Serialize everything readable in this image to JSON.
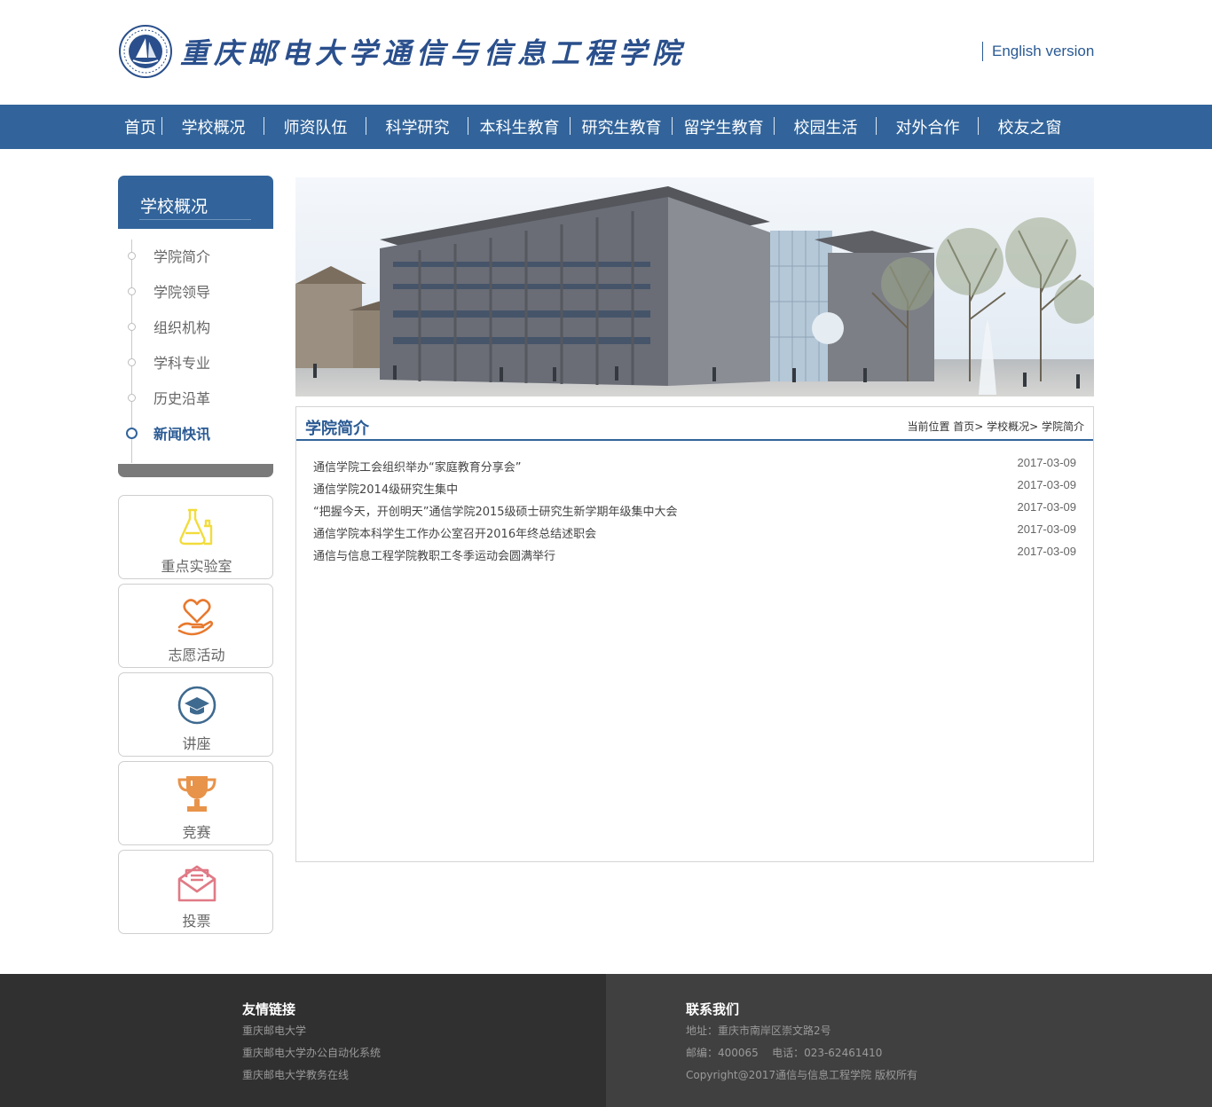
{
  "header": {
    "site_title": "重庆邮电大学通信与信息工程学院",
    "english_link": "English version"
  },
  "nav": {
    "items": [
      "首页",
      "学校概况",
      "师资队伍",
      "科学研究",
      "本科生教育",
      "研究生教育",
      "留学生教育",
      "校园生活",
      "对外合作",
      "校友之窗"
    ]
  },
  "sidebar": {
    "title": "学校概况",
    "items": [
      {
        "label": "学院简介",
        "active": false
      },
      {
        "label": "学院领导",
        "active": false
      },
      {
        "label": "组织机构",
        "active": false
      },
      {
        "label": "学科专业",
        "active": false
      },
      {
        "label": "历史沿革",
        "active": false
      },
      {
        "label": "新闻快讯",
        "active": true
      }
    ]
  },
  "quick_links": [
    {
      "label": "重点实验室",
      "icon": "lab-flask-icon",
      "color": "#f2dc3c"
    },
    {
      "label": "志愿活动",
      "icon": "heart-hand-icon",
      "color": "#e8792e"
    },
    {
      "label": "讲座",
      "icon": "graduation-cap-icon",
      "color": "#3f6a8f"
    },
    {
      "label": "竞赛",
      "icon": "trophy-icon",
      "color": "#e8934a"
    },
    {
      "label": "投票",
      "icon": "envelope-icon",
      "color": "#e07a86"
    }
  ],
  "content": {
    "title": "学院简介",
    "breadcrumb": "当前位置 首页> 学校概况> 学院简介",
    "news": [
      {
        "title": "通信学院工会组织举办“家庭教育分享会”",
        "date": "2017-03-09"
      },
      {
        "title": "通信学院2014级研究生集中",
        "date": "2017-03-09"
      },
      {
        "title": "“把握今天，开创明天”通信学院2015级硕士研究生新学期年级集中大会",
        "date": "2017-03-09"
      },
      {
        "title": "通信学院本科学生工作办公室召开2016年终总结述职会",
        "date": "2017-03-09"
      },
      {
        "title": "通信与信息工程学院教职工冬季运动会圆满举行",
        "date": "2017-03-09"
      }
    ]
  },
  "footer": {
    "links_title": "友情链接",
    "links": [
      "重庆邮电大学",
      "重庆邮电大学办公自动化系统",
      "重庆邮电大学教务在线"
    ],
    "contact_title": "联系我们",
    "contact": [
      "地址：重庆市南岸区崇文路2号",
      "邮编：400065    电话：023-62461410",
      "Copyright@2017通信与信息工程学院 版权所有"
    ]
  },
  "colors": {
    "brand_blue": "#32649b",
    "footer_left": "#303030",
    "footer_right": "#404040"
  }
}
